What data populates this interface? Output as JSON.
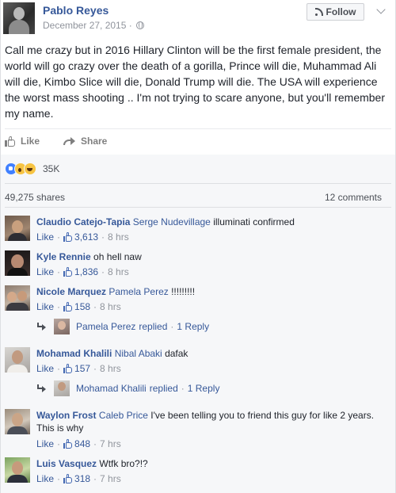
{
  "post": {
    "author": "Pablo Reyes",
    "date": "December 27, 2015",
    "meta_separator": "·",
    "follow_label": "Follow",
    "text": "Call me crazy but in 2016 Hillary Clinton will be the first female president, the world will go crazy over the death of a gorilla, Prince will die, Muhammad Ali will die, Kimbo Slice will die, Donald Trump will die. The USA will experience the worst mass shooting .. I'm not trying to scare anyone, but you'll remember my name."
  },
  "actions": {
    "like_label": "Like",
    "share_label": "Share"
  },
  "summary": {
    "reactions": [
      "like-icon",
      "wow-icon",
      "haha-icon"
    ],
    "reactions_count": "35K",
    "shares": "49,275 shares",
    "comments": "12 comments"
  },
  "comments": [
    {
      "name": "Claudio Catejo-Tapia",
      "tag": "Serge Nudevillage",
      "text": " illuminati confirmed",
      "like": "Like",
      "sep": "·",
      "likes": "3,613",
      "time": "8 hrs"
    },
    {
      "name": "Kyle Rennie",
      "tag": "",
      "text": " oh hell naw",
      "like": "Like",
      "sep": "·",
      "likes": "1,836",
      "time": "8 hrs"
    },
    {
      "name": "Nicole Marquez",
      "tag": "Pamela Perez",
      "text": " !!!!!!!!!",
      "like": "Like",
      "sep": "·",
      "likes": "158",
      "time": "8 hrs",
      "reply": {
        "name": "Pamela Perez",
        "action": "replied",
        "sep": "·",
        "count": "1 Reply"
      }
    },
    {
      "name": "Mohamad Khalili",
      "tag": "Nibal Abaki",
      "text": " dafak",
      "like": "Like",
      "sep": "·",
      "likes": "157",
      "time": "8 hrs",
      "reply": {
        "name": "Mohamad Khalili",
        "action": "replied",
        "sep": "·",
        "count": "1 Reply"
      }
    },
    {
      "name": "Waylon Frost",
      "tag": "Caleb Price",
      "text": " I've been telling you to friend this guy for like 2 years. This is why",
      "like": "Like",
      "sep": "·",
      "likes": "848",
      "time": "7 hrs"
    },
    {
      "name": "Luis Vasquez",
      "tag": "",
      "text": " Wtfk bro?!?",
      "like": "Like",
      "sep": "·",
      "likes": "318",
      "time": "7 hrs"
    }
  ],
  "colors": {
    "link": "#365899",
    "meta": "#90949c",
    "panel": "#f6f7f9",
    "like_reaction": "#4080ff",
    "emoji_yellow": "#f7c443"
  }
}
